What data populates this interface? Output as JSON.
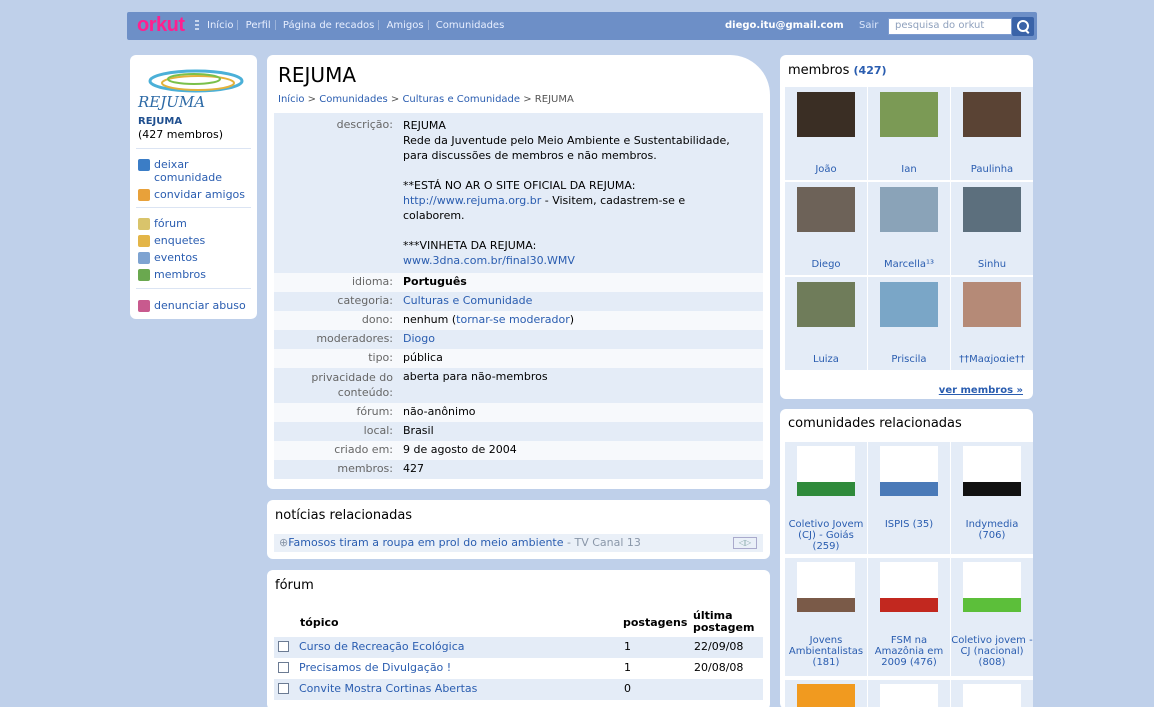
{
  "topbar": {
    "logo": "orkut",
    "nav": [
      "Início",
      "Perfil",
      "Página de recados",
      "Amigos",
      "Comunidades"
    ],
    "user_email": "diego.itu@gmail.com",
    "logout": "Sair",
    "search_placeholder": "pesquisa do orkut"
  },
  "sidebar": {
    "logo_text": "REJUMA",
    "community_name": "REJUMA",
    "member_count": "(427 membros)",
    "actions": [
      {
        "label": "deixar comunidade",
        "icon": "leave-icon"
      },
      {
        "label": "convidar amigos",
        "icon": "invite-icon"
      }
    ],
    "sections": [
      {
        "label": "fórum",
        "icon": "forum-icon"
      },
      {
        "label": "enquetes",
        "icon": "poll-icon"
      },
      {
        "label": "eventos",
        "icon": "calendar-icon"
      },
      {
        "label": "membros",
        "icon": "members-icon"
      }
    ],
    "report": {
      "label": "denunciar abuso",
      "icon": "report-icon"
    }
  },
  "community": {
    "title": "REJUMA",
    "breadcrumb": [
      "Início",
      "Comunidades",
      "Culturas e Comunidade",
      "REJUMA"
    ],
    "info": {
      "descricao_label": "descrição:",
      "descricao_lines": [
        "REJUMA",
        "Rede da Juventude pelo Meio Ambiente e Sustentabilidade,",
        "para discussões de membros e não membros.",
        "",
        "**ESTÁ NO AR O SITE OFICIAL DA REJUMA:"
      ],
      "site_link": "http://www.rejuma.org.br",
      "site_suffix": " - Visitem, cadastrem-se e",
      "site_suffix2": "colaborem.",
      "vinheta": "***VINHETA DA REJUMA:",
      "vinheta_link": "www.3dna.com.br/final30.WMV",
      "idioma_label": "idioma:",
      "idioma": "Português",
      "categoria_label": "categoria:",
      "categoria": "Culturas e Comunidade",
      "dono_label": "dono:",
      "dono_prefix": "nenhum (",
      "dono_link": "tornar-se moderador",
      "dono_suffix": ")",
      "moderadores_label": "moderadores:",
      "moderadores": "Diogo",
      "tipo_label": "tipo:",
      "tipo": "pública",
      "privacidade_label": "privacidade do conteúdo:",
      "privacidade": "aberta para não-membros",
      "forum_label": "fórum:",
      "forum": "não-anônimo",
      "local_label": "local:",
      "local": "Brasil",
      "criado_label": "criado em:",
      "criado": "9 de agosto de 2004",
      "membros_label": "membros:",
      "membros": "427"
    }
  },
  "news": {
    "heading": "notícias relacionadas",
    "item": "Famosos tiram a roupa em prol do meio ambiente",
    "source": " - TV Canal 13"
  },
  "forum": {
    "heading": "fórum",
    "columns": {
      "topic": "tópico",
      "posts": "postagens",
      "last": "última postagem"
    },
    "rows": [
      {
        "topic": "Curso de Recreação Ecológica",
        "posts": "1",
        "last": "22/09/08"
      },
      {
        "topic": "Precisamos de Divulgação !",
        "posts": "1",
        "last": "20/08/08"
      },
      {
        "topic": "Convite Mostra Cortinas Abertas",
        "posts": "0",
        "last": ""
      }
    ]
  },
  "members": {
    "heading": "membros",
    "count": "(427)",
    "people": [
      {
        "name": "João",
        "color": "#3a2e24"
      },
      {
        "name": "Ian",
        "color": "#7b9a55"
      },
      {
        "name": "Paulinha",
        "color": "#5a4334"
      },
      {
        "name": "Diego",
        "color": "#6d6258"
      },
      {
        "name": "Marcella¹³",
        "color": "#8aa3b8"
      },
      {
        "name": "Sinhu",
        "color": "#5c6f7d"
      },
      {
        "name": "Luiza",
        "color": "#6f7c5a"
      },
      {
        "name": "Priscila",
        "color": "#7aa6c7"
      },
      {
        "name": "††Maαjoαie††",
        "color": "#b58a77"
      }
    ],
    "see_all": "ver membros »"
  },
  "related": {
    "heading": "comunidades relacionadas",
    "items": [
      {
        "name": "Coletivo Jovem (CJ) - Goiás (259)",
        "color": "#2f8a3b"
      },
      {
        "name": "ISPIS (35)",
        "color": "#4a7ab8"
      },
      {
        "name": "Indymedia (706)",
        "color": "#111111"
      },
      {
        "name": "Jovens Ambientalistas (181)",
        "color": "#7a5a48"
      },
      {
        "name": "FSM na Amazônia em 2009 (476)",
        "color": "#c2281f"
      },
      {
        "name": "Coletivo jovem - CJ (nacional) (808)",
        "color": "#5cbf3a"
      }
    ]
  }
}
